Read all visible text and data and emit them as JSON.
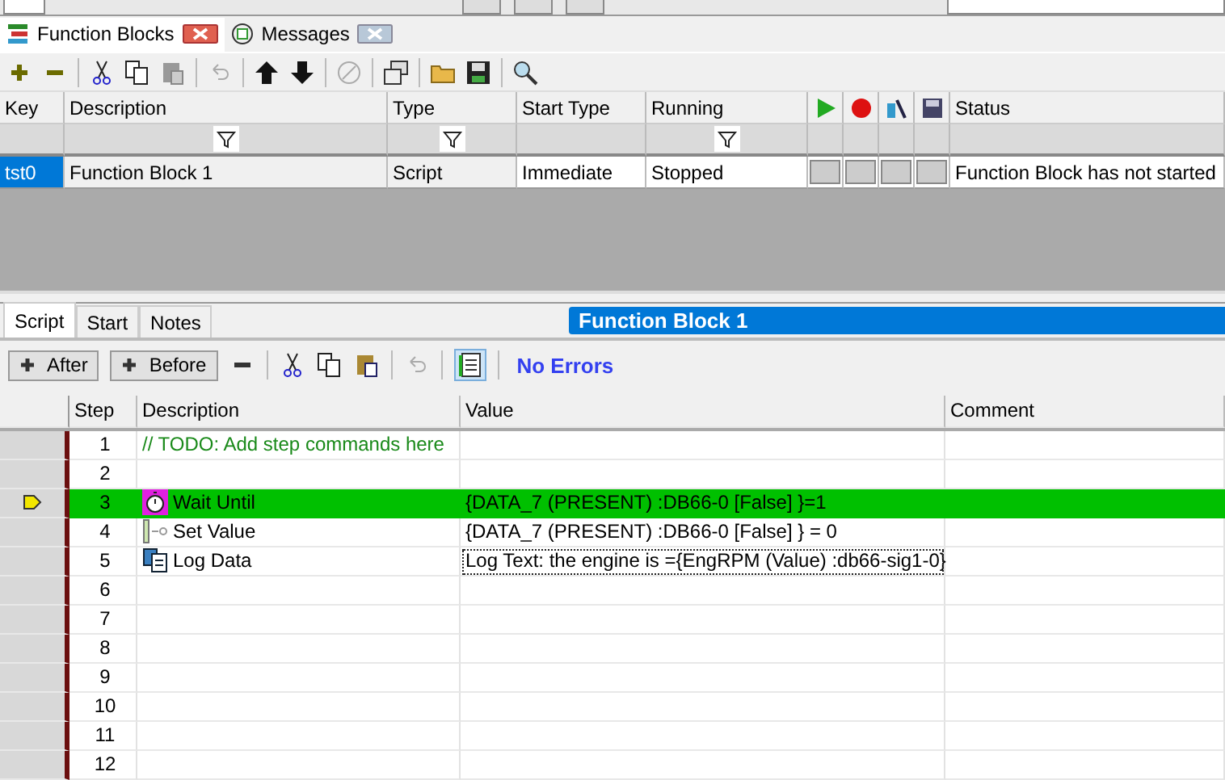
{
  "panel_tabs": [
    {
      "label": "Function Blocks",
      "selected": true
    },
    {
      "label": "Messages",
      "selected": false
    }
  ],
  "blocks_table": {
    "columns": [
      "Key",
      "Description",
      "Type",
      "Start Type",
      "Running",
      "Status"
    ],
    "filters": [
      false,
      true,
      true,
      false,
      true,
      false
    ],
    "rows": [
      {
        "key": "tst0",
        "description": "Function Block 1",
        "type": "Script",
        "start_type": "Immediate",
        "running": "Stopped",
        "status": "Function Block has not started",
        "selected": true
      }
    ]
  },
  "editor_tabs": [
    {
      "label": "Script",
      "selected": true
    },
    {
      "label": "Start",
      "selected": false
    },
    {
      "label": "Notes",
      "selected": false
    }
  ],
  "editor_title": "Function Block 1",
  "step_buttons": [
    "After",
    "Before"
  ],
  "validation": "No Errors",
  "script_table": {
    "columns": [
      "Step",
      "Description",
      "Value",
      "Comment"
    ],
    "rows": [
      {
        "step": "1",
        "kind": "comment",
        "description": "// TODO: Add step commands here",
        "current": false,
        "selected": false,
        "focused": false
      },
      {
        "step": "2",
        "kind": "empty",
        "current": false,
        "selected": false,
        "focused": false
      },
      {
        "step": "3",
        "kind": "wait",
        "description": "Wait Until",
        "value": "{DATA_7 (PRESENT) :DB66-0 [False] }=1",
        "current": true,
        "selected": true,
        "focused": false
      },
      {
        "step": "4",
        "kind": "set",
        "description": "Set Value",
        "value": "{DATA_7 (PRESENT) :DB66-0 [False] } = 0",
        "current": false,
        "selected": false,
        "focused": false
      },
      {
        "step": "5",
        "kind": "log",
        "description": "Log Data",
        "value": "Log Text: the engine is ={EngRPM (Value) :db66-sig1-0}",
        "current": false,
        "selected": false,
        "focused": true
      },
      {
        "step": "6",
        "kind": "empty",
        "current": false,
        "selected": false,
        "focused": false
      },
      {
        "step": "7",
        "kind": "empty",
        "current": false,
        "selected": false,
        "focused": false
      },
      {
        "step": "8",
        "kind": "empty",
        "current": false,
        "selected": false,
        "focused": false
      },
      {
        "step": "9",
        "kind": "empty",
        "current": false,
        "selected": false,
        "focused": false
      },
      {
        "step": "10",
        "kind": "empty",
        "current": false,
        "selected": false,
        "focused": false
      },
      {
        "step": "11",
        "kind": "empty",
        "current": false,
        "selected": false,
        "focused": false
      },
      {
        "step": "12",
        "kind": "empty",
        "current": false,
        "selected": false,
        "focused": false
      }
    ]
  }
}
